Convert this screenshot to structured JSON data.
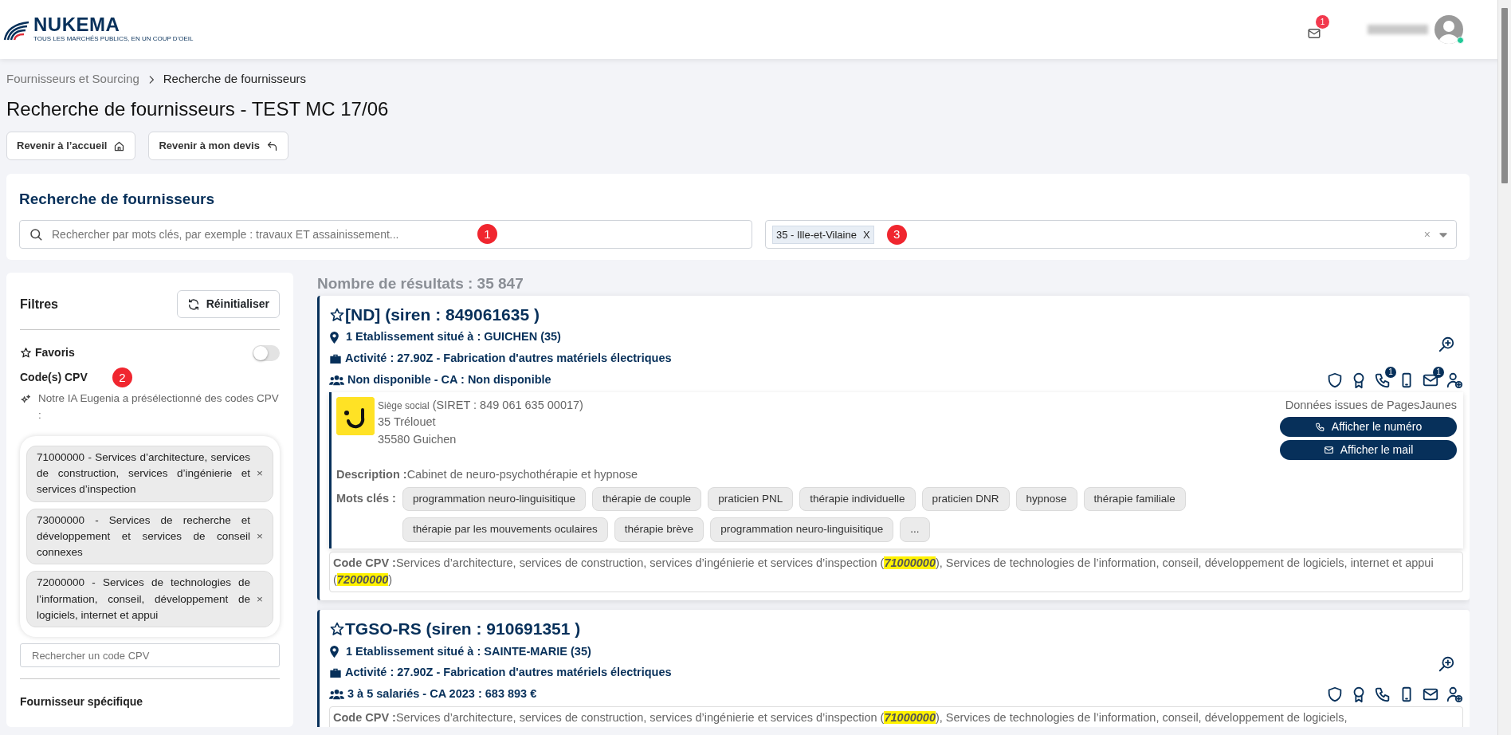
{
  "header": {
    "logo": "NUKEMA",
    "tagline": "TOUS LES MARCHÉS PUBLICS, EN UN COUP D'OEIL",
    "mail_count": "1",
    "user_online": true
  },
  "breadcrumb": [
    {
      "label": "Fournisseurs et Sourcing",
      "current": false
    },
    {
      "label": "Recherche de fournisseurs",
      "current": true
    }
  ],
  "page_title": "Recherche de fournisseurs - TEST MC 17/06",
  "action_buttons": [
    {
      "kind": "home",
      "label": "Revenir à l’accueil"
    },
    {
      "kind": "back",
      "label": "Revenir à mon devis"
    }
  ],
  "search_panel": {
    "title": "Recherche de fournisseurs",
    "keyword": {
      "placeholder": "Rechercher par mots clés, par exemple : travaux ET assainissement...",
      "marker": "1"
    },
    "location": {
      "tags": [
        {
          "label": "35 - Ille-et-Vilaine",
          "remove": "X"
        }
      ],
      "clear": "×",
      "marker": "3"
    }
  },
  "filters": {
    "title": "Filtres",
    "reset": "Réinitialiser",
    "favorites": {
      "label": "Favoris",
      "on": false
    },
    "cpv": {
      "label": "Code(s) CPV",
      "marker": "2",
      "ai_note": "Notre IA Eugenia a présélectionné des codes CPV :",
      "codes": [
        {
          "label": "71000000 - Services d’architecture, services de construction, services d’ingénierie et services d’inspection",
          "remove": "×"
        },
        {
          "label": "73000000 - Services de recherche et développement et services de conseil connexes",
          "remove": "×"
        },
        {
          "label": "72000000 - Services de technologies de l’information, conseil, développement de logiciels, internet et appui",
          "remove": "×"
        }
      ],
      "search_placeholder": "Rechercher un code CPV"
    },
    "specific_supplier": {
      "label": "Fournisseur spécifique"
    }
  },
  "results": {
    "count": "Nombre de résultats : 35 847",
    "suppliers": [
      {
        "name": "[ND] (siren : 849061635 )",
        "favorite": false,
        "location": "1 Etablissement situé à : GUICHEN (35)",
        "activity": "Activité : 27.90Z - Fabrication d'autres matériels électriques",
        "staff": "Non disponible - CA : Non disponible",
        "contacts": [
          {
            "kind": "shield"
          },
          {
            "kind": "award"
          },
          {
            "kind": "phone",
            "count": "1"
          },
          {
            "kind": "mobile"
          },
          {
            "kind": "mail",
            "count": "1"
          },
          {
            "kind": "add-user"
          }
        ],
        "pagesjaunes": {
          "siege_label": "Siège social",
          "siret": "(SIRET : 849 061 635 00017)",
          "address": [
            "35 Trélouet",
            "35580 Guichen"
          ],
          "source": "Données issues de PagesJaunes",
          "buttons": [
            {
              "kind": "phone",
              "label": "Afficher le numéro"
            },
            {
              "kind": "mail",
              "label": "Afficher le mail"
            }
          ],
          "description_label": "Description :",
          "description": "Cabinet de neuro-psychothérapie et hypnose",
          "keywords_label": "Mots clés :",
          "keywords": [
            "programmation neuro-linguisitique",
            "thérapie de couple",
            "praticien PNL",
            "thérapie individuelle",
            "praticien DNR",
            "hypnose",
            "thérapie familiale",
            "thérapie par les mouvements oculaires",
            "thérapie brève",
            "programmation neuro-linguisitique",
            "..."
          ]
        },
        "cpv": {
          "label": "Code CPV :",
          "parts": [
            {
              "text": "Services d’architecture, services de construction, services d’ingénierie et services d’inspection (",
              "highlighted": false
            },
            {
              "text": "71000000",
              "highlighted": true
            },
            {
              "text": "), Services de technologies de l’information, conseil, développement de logiciels, internet et appui (",
              "highlighted": false
            },
            {
              "text": "72000000",
              "highlighted": true
            },
            {
              "text": ")",
              "highlighted": false
            }
          ]
        }
      },
      {
        "name": "TGSO-RS (siren : 910691351 )",
        "favorite": false,
        "location": "1 Etablissement situé à : SAINTE-MARIE (35)",
        "activity": "Activité : 27.90Z - Fabrication d'autres matériels électriques",
        "staff": "3 à 5 salariés - CA 2023 : 683 893 €",
        "contacts": [
          {
            "kind": "shield"
          },
          {
            "kind": "award"
          },
          {
            "kind": "phone"
          },
          {
            "kind": "mobile"
          },
          {
            "kind": "mail"
          },
          {
            "kind": "add-user"
          }
        ],
        "cpv": {
          "label": "Code CPV :",
          "parts": [
            {
              "text": "Services d’architecture, services de construction, services d’ingénierie et services d’inspection (",
              "highlighted": false
            },
            {
              "text": "71000000",
              "highlighted": true
            },
            {
              "text": "), Services de technologies de l’information, conseil, développement de logiciels,",
              "highlighted": false
            }
          ]
        }
      }
    ]
  }
}
